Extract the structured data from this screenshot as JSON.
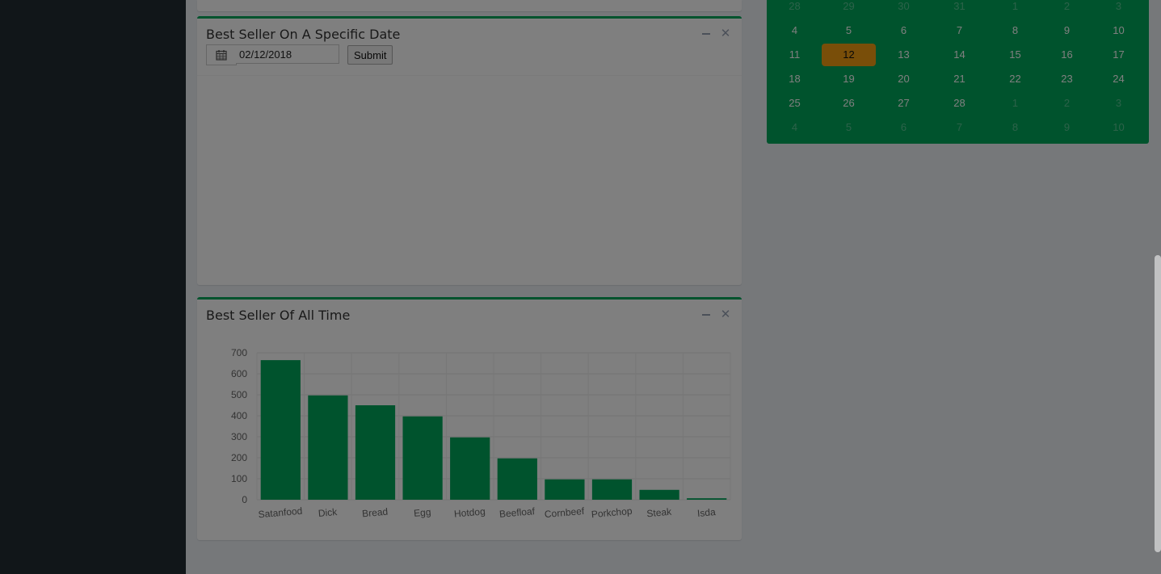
{
  "date_box": {
    "title": "Best Seller On A Specific Date",
    "date_value": "02/12/2018",
    "submit_label": "Submit",
    "icons": [
      "calendar-icon",
      "minus-icon",
      "close-icon"
    ]
  },
  "all_time_box": {
    "title": "Best Seller Of All Time",
    "icons": [
      "minus-icon",
      "close-icon"
    ]
  },
  "calendar": {
    "rows": [
      [
        "28",
        "29",
        "30",
        "31",
        "1",
        "2",
        "3"
      ],
      [
        "4",
        "5",
        "6",
        "7",
        "8",
        "9",
        "10"
      ],
      [
        "11",
        "12",
        "13",
        "14",
        "15",
        "16",
        "17"
      ],
      [
        "18",
        "19",
        "20",
        "21",
        "22",
        "23",
        "24"
      ],
      [
        "25",
        "26",
        "27",
        "28",
        "1",
        "2",
        "3"
      ],
      [
        "4",
        "5",
        "6",
        "7",
        "8",
        "9",
        "10"
      ]
    ],
    "muted_rows": [
      0,
      5
    ],
    "selected_day": "12",
    "colors": {
      "background": "#00a65a",
      "selected": "#f39c12"
    }
  },
  "colors": {
    "accent": "#00a65a",
    "sidebar": "#222d32",
    "bar": "#00a65a"
  },
  "chart_data": {
    "type": "bar",
    "categories": [
      "Satanfood",
      "Dick",
      "Bread",
      "Egg",
      "Hotdog",
      "Beefloaf",
      "Cornbeef",
      "Porkchop",
      "Steak",
      "Isda"
    ],
    "values": [
      665,
      497,
      450,
      397,
      297,
      197,
      97,
      97,
      47,
      7
    ],
    "yticks": [
      0,
      100,
      200,
      300,
      400,
      500,
      600,
      700
    ],
    "ylim": [
      0,
      700
    ],
    "grid": true,
    "title": "",
    "xlabel": "",
    "ylabel": ""
  }
}
